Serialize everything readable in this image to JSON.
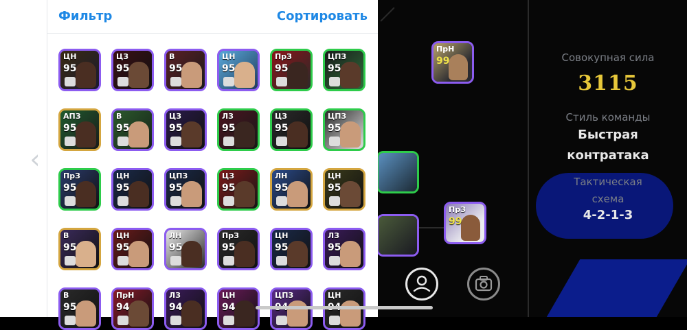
{
  "header": {
    "filter_label": "Фильтр",
    "sort_label": "Сортировать"
  },
  "cards": [
    {
      "pos": "ЦН",
      "ovr": "95"
    },
    {
      "pos": "ЦЗ",
      "ovr": "95"
    },
    {
      "pos": "В",
      "ovr": "95"
    },
    {
      "pos": "ЦН",
      "ovr": "95"
    },
    {
      "pos": "ПрЗ",
      "ovr": "95"
    },
    {
      "pos": "ЦПЗ",
      "ovr": "95"
    },
    {
      "pos": "АПЗ",
      "ovr": "95"
    },
    {
      "pos": "В",
      "ovr": "95"
    },
    {
      "pos": "ЦЗ",
      "ovr": "95"
    },
    {
      "pos": "ЛЗ",
      "ovr": "95"
    },
    {
      "pos": "ЦЗ",
      "ovr": "95"
    },
    {
      "pos": "ЦПЗ",
      "ovr": "95"
    },
    {
      "pos": "ПрЗ",
      "ovr": "95"
    },
    {
      "pos": "ЦН",
      "ovr": "95"
    },
    {
      "pos": "ЦПЗ",
      "ovr": "95"
    },
    {
      "pos": "ЦЗ",
      "ovr": "95"
    },
    {
      "pos": "ЛН",
      "ovr": "95"
    },
    {
      "pos": "ЦН",
      "ovr": "95"
    },
    {
      "pos": "В",
      "ovr": "95"
    },
    {
      "pos": "ЦН",
      "ovr": "95"
    },
    {
      "pos": "ЛН",
      "ovr": "95"
    },
    {
      "pos": "ПрЗ",
      "ovr": "95"
    },
    {
      "pos": "ЦН",
      "ovr": "95"
    },
    {
      "pos": "ЛЗ",
      "ovr": "95"
    },
    {
      "pos": "В",
      "ovr": "95"
    },
    {
      "pos": "ПрН",
      "ovr": "94"
    },
    {
      "pos": "ЛЗ",
      "ovr": "94"
    },
    {
      "pos": "ЦН",
      "ovr": "94"
    },
    {
      "pos": "ЦПЗ",
      "ovr": "94"
    },
    {
      "pos": "ЦН",
      "ovr": "94"
    }
  ],
  "pitch_cards": [
    {
      "pos": "ПрН",
      "ovr": "99"
    },
    {
      "pos": "ПрЗ",
      "ovr": "99"
    }
  ],
  "team": {
    "strength_label": "Совокупная сила",
    "strength_value": "3115",
    "style_label": "Стиль команды",
    "style_value_line1": "Быстрая",
    "style_value_line2": "контратака",
    "tactic_label_line1": "Тактическая",
    "tactic_label_line2": "схема",
    "tactic_value": "4-2-1-3"
  },
  "icons": {
    "back": "chevron-left-icon",
    "profile": "person-icon",
    "camera": "camera-icon"
  },
  "colors": {
    "accent": "#1e88e5",
    "strength": "#e6c73a"
  }
}
